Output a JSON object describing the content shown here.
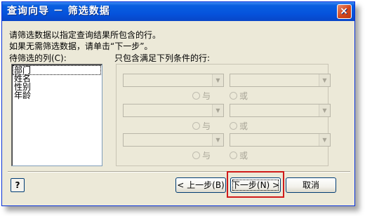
{
  "window": {
    "title": "查询向导 － 筛选数据",
    "close_label": "×"
  },
  "instructions": {
    "line1": "请筛选数据以指定查询结果所包含的行。",
    "line2": "如果无需筛选数据，请单击“下一步”。"
  },
  "columns_list": {
    "label": "待筛选的列(C):",
    "items": [
      "部门",
      "姓名",
      "性别",
      "年龄"
    ],
    "selected_index": 0
  },
  "conditions": {
    "label": "只包含满足下列条件的行:",
    "and_label": "与",
    "or_label": "或"
  },
  "buttons": {
    "help": "?",
    "back": "< 上一步(B)",
    "next": "下一步(N) >",
    "cancel": "取消"
  },
  "colors": {
    "title_bar": "#0553dc",
    "highlight_box": "#d01a1a"
  }
}
